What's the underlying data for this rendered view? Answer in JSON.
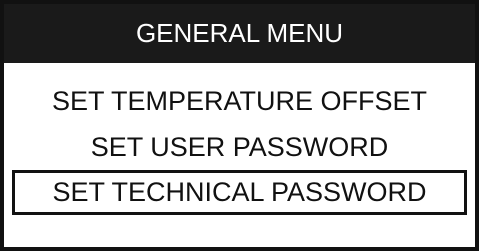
{
  "menu": {
    "title": "GENERAL MENU",
    "items": [
      {
        "label": "SET TEMPERATURE OFFSET",
        "selected": false
      },
      {
        "label": "SET USER PASSWORD",
        "selected": false
      },
      {
        "label": "SET TECHNICAL PASSWORD",
        "selected": true
      }
    ]
  },
  "colors": {
    "foreground": "#111111",
    "background": "#ffffff",
    "title_background": "#1a1a1a",
    "title_text": "#ffffff"
  }
}
